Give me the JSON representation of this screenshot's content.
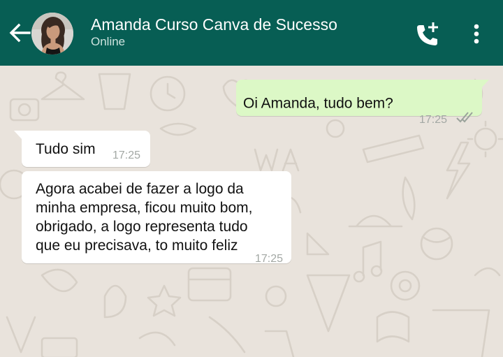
{
  "header": {
    "contact_name": "Amanda Curso Canva de Sucesso",
    "status": "Online",
    "back_icon": "arrow-left-icon",
    "call_icon": "add-call-icon",
    "menu_icon": "more-vertical-icon"
  },
  "messages": [
    {
      "direction": "outgoing",
      "text": "Oi Amanda, tudo bem?",
      "time": "17:25",
      "status_icon": "double-check-icon"
    },
    {
      "direction": "incoming",
      "text": "Tudo sim",
      "time": "17:25"
    },
    {
      "direction": "incoming",
      "lines": [
        "Agora acabei de fazer a logo da",
        "minha empresa, ficou muito bom,",
        "obrigado, a logo representa tudo",
        "que eu precisava, to muito feliz"
      ],
      "time": "17:25"
    }
  ],
  "colors": {
    "header": "#075e54",
    "chat_background": "#e9e3dc",
    "outgoing_bubble": "#dcf8c6",
    "incoming_bubble": "#ffffff",
    "timestamp": "#a3a8a4"
  }
}
